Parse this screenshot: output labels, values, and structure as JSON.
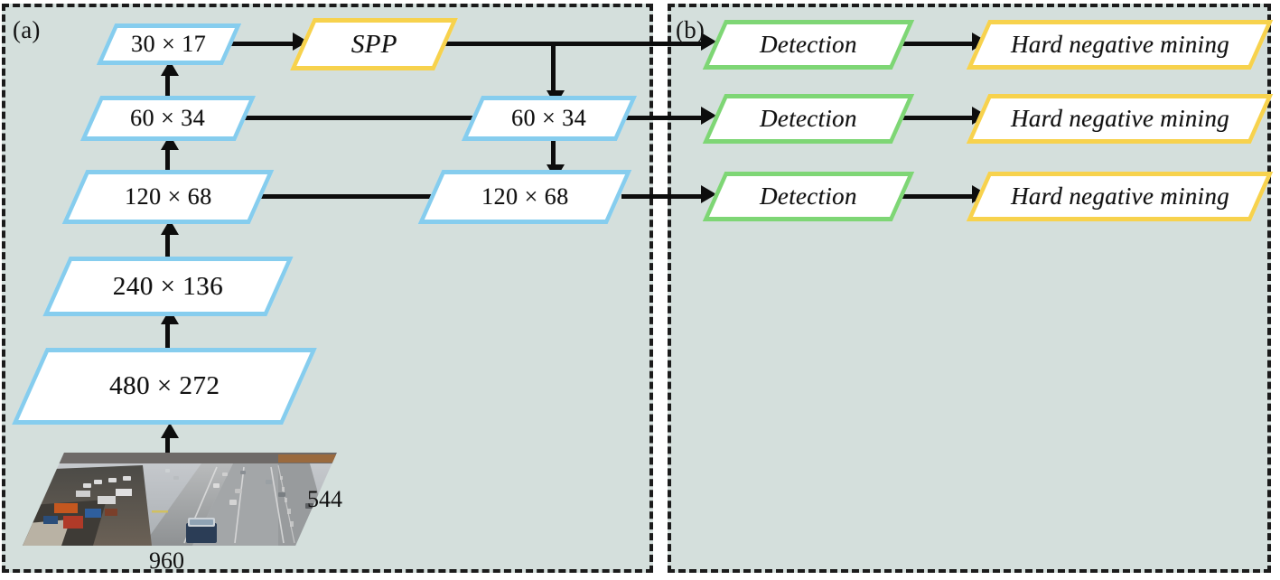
{
  "panels": {
    "a": {
      "label": "(a)"
    },
    "b": {
      "label": "(b)"
    }
  },
  "backbone": {
    "layers": [
      {
        "name": "level-480x272",
        "label": "480 × 272"
      },
      {
        "name": "level-240x136",
        "label": "240 × 136"
      },
      {
        "name": "level-120x68",
        "label": "120 × 68"
      },
      {
        "name": "level-60x34",
        "label": "60 × 34"
      },
      {
        "name": "level-30x17",
        "label": "30 × 17"
      }
    ]
  },
  "spp": {
    "label": "SPP"
  },
  "fpn": {
    "nodes": [
      {
        "name": "fpn-60x34",
        "label": "60 × 34"
      },
      {
        "name": "fpn-120x68",
        "label": "120 × 68"
      }
    ]
  },
  "detection_heads": [
    {
      "detection": "Detection",
      "mining": "Hard negative mining"
    },
    {
      "detection": "Detection",
      "mining": "Hard negative mining"
    },
    {
      "detection": "Detection",
      "mining": "Hard negative mining"
    }
  ],
  "input": {
    "name": "input-image",
    "description": "aerial traffic highway scene",
    "width_label": "960",
    "height_label": "544"
  },
  "colors": {
    "panel_background": "#d4dfdc",
    "dashed_border": "#1b1b1b",
    "feature_blue": "#86cdee",
    "spp_yellow": "#f7d24d",
    "detection_green": "#7ed675",
    "mining_yellow": "#f7d24d",
    "arrow": "#0d0d0d",
    "node_fill": "#ffffff"
  }
}
